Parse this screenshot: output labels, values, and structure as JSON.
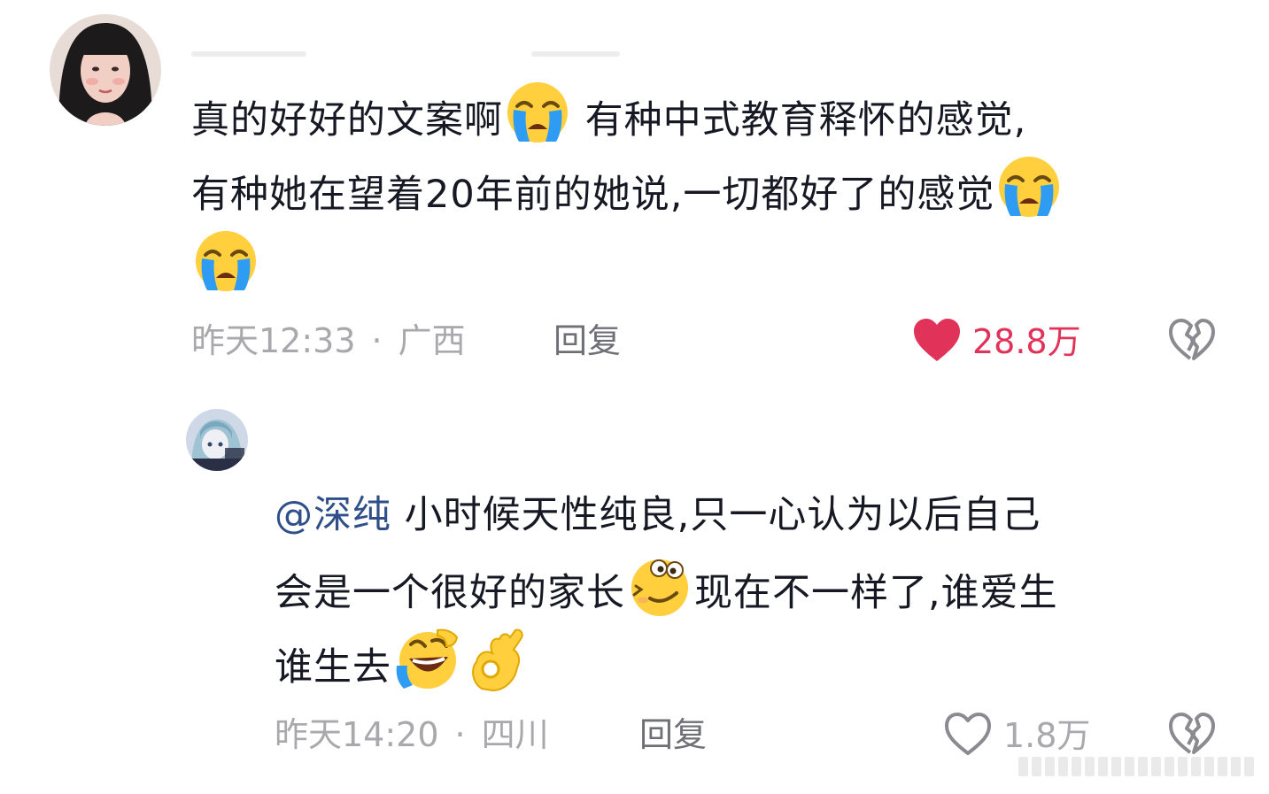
{
  "comment1": {
    "avatar_icon": "user-avatar-girl",
    "text_line1_a": "真的好好的文案啊",
    "text_line1_b": " 有种中式教育释怀的感觉,",
    "text_line2": "有种她在望着20年前的她说,一切都好了的感觉",
    "emojis": [
      "loudly-crying-face-icon",
      "loudly-crying-face-icon",
      "loudly-crying-face-icon"
    ],
    "time": "昨天12:33",
    "separator": "·",
    "location": "广西",
    "reply_label": "回复",
    "like_count": "28.8万",
    "liked": true,
    "like_color": "#e1325a"
  },
  "reply1": {
    "avatar_icon": "user-avatar-anime",
    "mention": "@深纯",
    "text_line1": " 小时候天性纯良,只一心认为以后自己",
    "text_line2_a": "会是一个很好的家长",
    "text_line2_b": "现在不一样了,谁爱生",
    "text_line3": "谁生去",
    "emojis": [
      "woozy-face-icon",
      "rolling-laughing-face-icon",
      "ok-hand-icon"
    ],
    "time": "昨天14:20",
    "separator": "·",
    "location": "四川",
    "reply_label": "回复",
    "like_count": "1.8万",
    "liked": false
  }
}
